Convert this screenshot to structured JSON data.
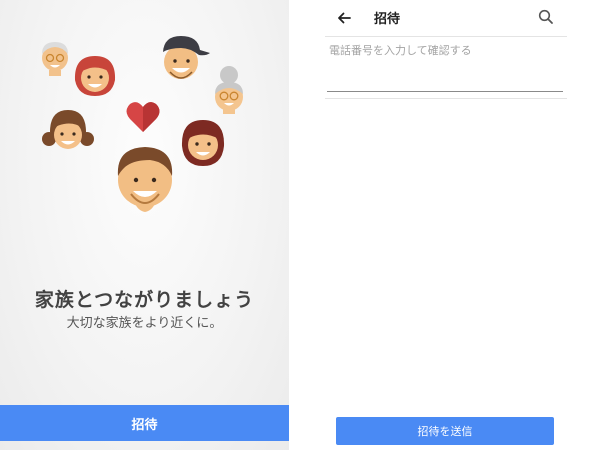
{
  "left_screen": {
    "headline": "家族とつながりましょう",
    "subline": "大切な家族をより近くに。",
    "invite_button": "招待"
  },
  "right_screen": {
    "title": "招待",
    "phone_placeholder": "電話番号を入力して確認する",
    "phone_value": "",
    "send_button": "招待を送信"
  },
  "icons": {
    "back": "arrow-left-icon",
    "search": "search-icon",
    "heart": "heart-icon"
  },
  "colors": {
    "accent": "#4a8af4",
    "heart": "#d64545"
  }
}
